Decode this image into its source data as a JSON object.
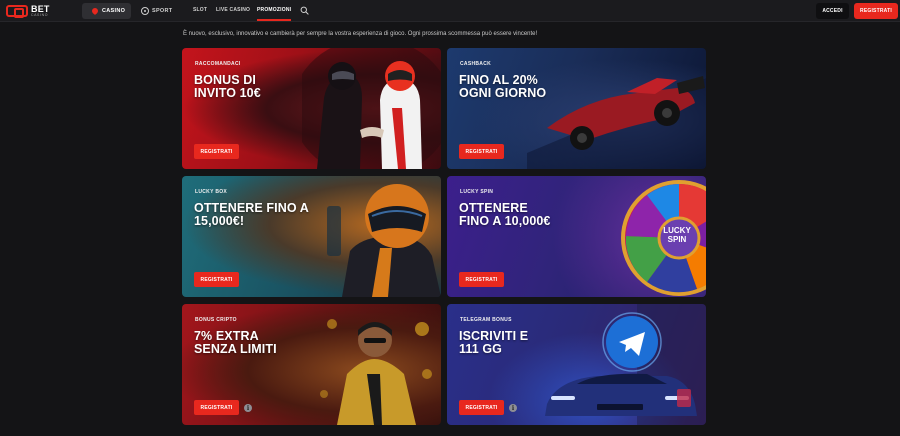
{
  "header": {
    "logo_text": "BET",
    "logo_sub": "CASINO",
    "segments": [
      {
        "label": "CASINO",
        "icon": "spade-icon",
        "active": true
      },
      {
        "label": "SPORT",
        "icon": "soccer-ball-icon",
        "active": false
      }
    ],
    "nav": [
      "SLOT",
      "LIVE CASINO",
      "PROMOZIONI"
    ],
    "active_nav": "PROMOZIONI",
    "login_label": "ACCEDI",
    "register_label": "REGISTRATI"
  },
  "intro_text": "È nuovo, esclusivo, innovativo e cambierà per sempre la vostra esperienza di gioco. Ogni prossima scommessa può essere vincente!",
  "promos": [
    {
      "tag": "RACCOMANDACI",
      "title": "BONUS DI\nINVITO 10€",
      "button": "REGISTRATI",
      "has_info": false
    },
    {
      "tag": "CASHBACK",
      "title": "FINO AL 20%\nOGNI GIORNO",
      "button": "REGISTRATI",
      "has_info": false
    },
    {
      "tag": "LUCKY BOX",
      "title": "OTTENERE FINO A\n15,000€!",
      "button": "REGISTRATI",
      "has_info": false
    },
    {
      "tag": "LUCKY SPIN",
      "title": "OTTENERE\nFINO A 10,000€",
      "button": "REGISTRATI",
      "has_info": false
    },
    {
      "tag": "BONUS CRIPTO",
      "title": "7% EXTRA\nSENZA LIMITI",
      "button": "REGISTRATI",
      "has_info": true
    },
    {
      "tag": "TELEGRAM BONUS",
      "title": "ISCRIVITI E\n111 GG",
      "button": "REGISTRATI",
      "has_info": true
    }
  ],
  "wheel_label": "LUCKY SPIN",
  "colors": {
    "accent": "#e8281e",
    "background": "#141416",
    "header": "#1b1b1e"
  }
}
